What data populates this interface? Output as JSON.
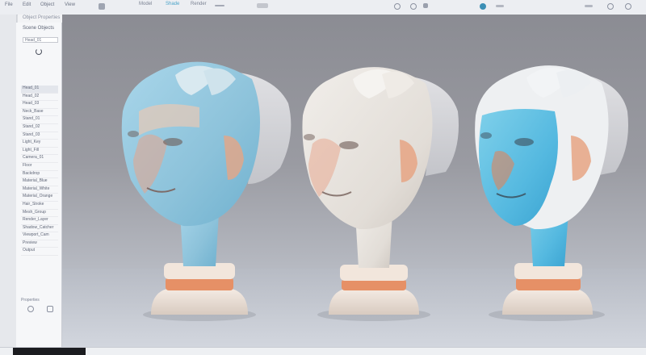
{
  "topbar": {
    "menus": [
      "File",
      "Edit",
      "Object",
      "View"
    ],
    "tabs": [
      "Model",
      "Shade",
      "Render"
    ]
  },
  "panel": {
    "title": "Object Properties"
  },
  "sidebar": {
    "title": "Scene Objects",
    "field_value": "Head_01",
    "items": [
      "Head_01",
      "Head_02",
      "Head_03",
      "Neck_Base",
      "Stand_01",
      "Stand_02",
      "Stand_03",
      "Light_Key",
      "Light_Fill",
      "Camera_01",
      "Floor",
      "Backdrop",
      "Material_Blue",
      "Material_White",
      "Material_Orange",
      "Hair_Stroke",
      "Mesh_Group",
      "Render_Layer",
      "Shadow_Catcher",
      "Viewport_Cam",
      "Preview",
      "Output"
    ],
    "selected_index": 0,
    "footer": "Properties"
  },
  "colors": {
    "skin_blue": "#8fc3da",
    "skin_white": "#e6e2dc",
    "accent_orange": "#e08a5a",
    "stand": "#efe3d8"
  },
  "icons": [
    "menu-icon",
    "settings-icon",
    "search-icon",
    "user-icon",
    "close-icon",
    "grid-icon"
  ]
}
